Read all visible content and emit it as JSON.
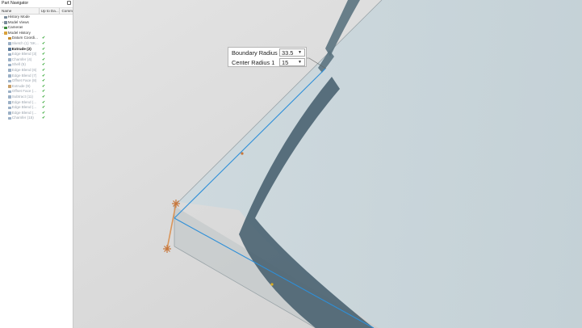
{
  "navigator": {
    "title": "Part Navigator",
    "columns": [
      "Name",
      "Up to Da...",
      "Comm"
    ],
    "rows": [
      {
        "label": "History Mode",
        "depth": 0,
        "twist": "",
        "icon": "#7a8a9a",
        "check": "",
        "style": ""
      },
      {
        "label": "Model Views",
        "depth": 0,
        "twist": "+",
        "icon": "#7a8a9a",
        "check": "",
        "style": ""
      },
      {
        "label": "Cameras",
        "depth": 0,
        "twist": "+",
        "icon": "#3a8a3a",
        "check": "",
        "style": ""
      },
      {
        "label": "Model History",
        "depth": 0,
        "twist": "-",
        "icon": "#d9a13b",
        "check": "",
        "style": ""
      },
      {
        "label": "Datum Coordi...",
        "depth": 1,
        "twist": "",
        "icon": "#c48a2a",
        "check": "✔",
        "style": ""
      },
      {
        "label": "Sketch (1) 'SK...",
        "depth": 1,
        "twist": "",
        "icon": "#9bb0c6",
        "check": "✔",
        "style": "dim"
      },
      {
        "label": "Extrude (2)",
        "depth": 1,
        "twist": "",
        "icon": "#5a7a9a",
        "check": "✔",
        "style": "bold"
      },
      {
        "label": "Edge Blend (3)",
        "depth": 1,
        "twist": "",
        "icon": "#9bb0c6",
        "check": "✔",
        "style": "dim"
      },
      {
        "label": "Chamfer (4)",
        "depth": 1,
        "twist": "",
        "icon": "#9bb0c6",
        "check": "✔",
        "style": "dim"
      },
      {
        "label": "Shell (5)",
        "depth": 1,
        "twist": "",
        "icon": "#9bb0c6",
        "check": "✔",
        "style": "dim"
      },
      {
        "label": "Edge Blend (6)",
        "depth": 1,
        "twist": "",
        "icon": "#9bb0c6",
        "check": "✔",
        "style": "dim"
      },
      {
        "label": "Edge Blend (7)",
        "depth": 1,
        "twist": "",
        "icon": "#9bb0c6",
        "check": "✔",
        "style": "dim"
      },
      {
        "label": "Offset Face (8)",
        "depth": 1,
        "twist": "",
        "icon": "#9bb0c6",
        "check": "✔",
        "style": "dim"
      },
      {
        "label": "Extrude (9)",
        "depth": 1,
        "twist": "",
        "icon": "#c9a06a",
        "check": "✔",
        "style": "dim"
      },
      {
        "label": "Offset Face (...",
        "depth": 1,
        "twist": "",
        "icon": "#9bb0c6",
        "check": "✔",
        "style": "dim"
      },
      {
        "label": "Subtract (11)",
        "depth": 1,
        "twist": "",
        "icon": "#9bb0c6",
        "check": "✔",
        "style": "dim"
      },
      {
        "label": "Edge Blend (...",
        "depth": 1,
        "twist": "",
        "icon": "#9bb0c6",
        "check": "✔",
        "style": "dim"
      },
      {
        "label": "Edge Blend (...",
        "depth": 1,
        "twist": "",
        "icon": "#9bb0c6",
        "check": "✔",
        "style": "dim"
      },
      {
        "label": "Edge Blend (...",
        "depth": 1,
        "twist": "",
        "icon": "#9bb0c6",
        "check": "✔",
        "style": "dim"
      },
      {
        "label": "Chamfer (15)",
        "depth": 1,
        "twist": "",
        "icon": "#9bb0c6",
        "check": "✔",
        "style": "dim"
      }
    ]
  },
  "popup": {
    "boundary_radius_label": "Boundary Radius 1",
    "boundary_radius_value": "33.5",
    "center_radius_label": "Center Radius 1",
    "center_radius_value": "15"
  },
  "colors": {
    "background": "#d9d9d9",
    "surface": "#c9d6db",
    "wall": "#47606e",
    "accent_blue": "#2e8fd8",
    "handle_orange": "#c7763a",
    "check_green": "#1f9d1f"
  }
}
